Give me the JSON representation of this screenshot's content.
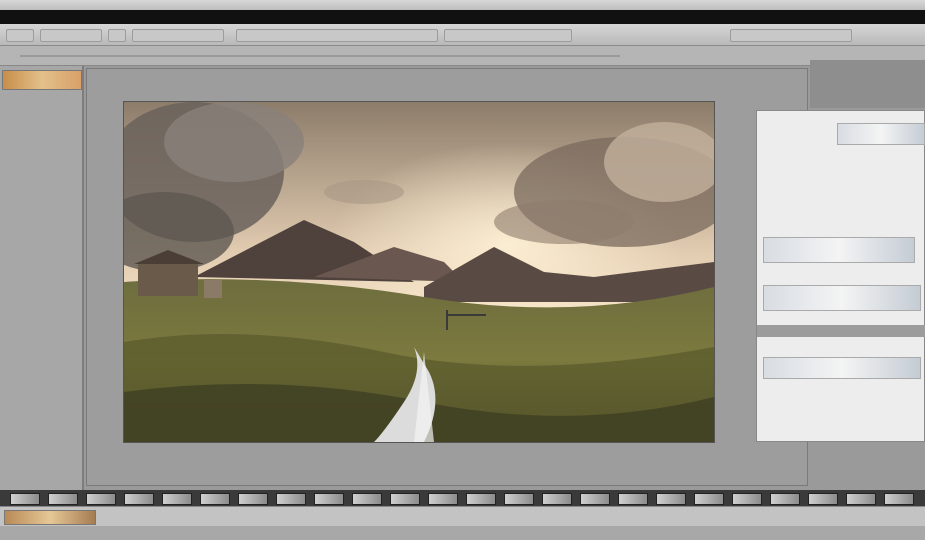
{
  "window": {
    "status_text": ""
  },
  "toolbar": {
    "buttons": [
      "move-tool",
      "zoom-tool",
      "hand-tool",
      "crop-tool",
      "brush-tool",
      "eraser-tool",
      "text-tool"
    ]
  },
  "canvas": {
    "image_description_icon": "landscape-photo"
  },
  "right_panel": {
    "rows": [
      "",
      "",
      "",
      "",
      "",
      "",
      "",
      "",
      ""
    ]
  },
  "colors": {
    "workspace": "#9d9d9d",
    "panel": "#ededed",
    "chrome_dark": "#111111"
  }
}
